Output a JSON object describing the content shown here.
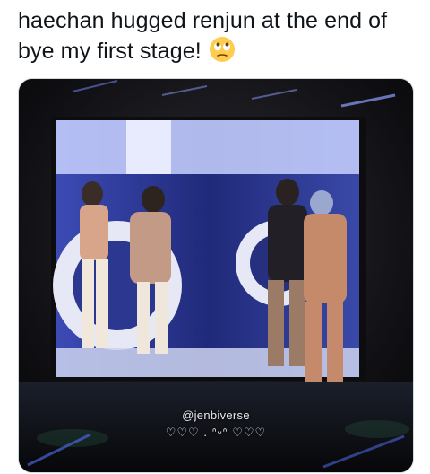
{
  "tweet": {
    "text": "haechan hugged renjun at the end of bye my first stage!",
    "emoji_icon": "face-with-rolling-eyes-emoji"
  },
  "media": {
    "watermark_handle": "@jenbiverse",
    "watermark_decoration": "♡♡♡ . ᐢᵕᐢ ♡♡♡",
    "description_icon": "concert-screen-video-frame"
  },
  "colors": {
    "text": "#0f1419",
    "border": "#cfd9de",
    "screen_blue": "#2a3a9a",
    "stage_dark": "#121212"
  }
}
